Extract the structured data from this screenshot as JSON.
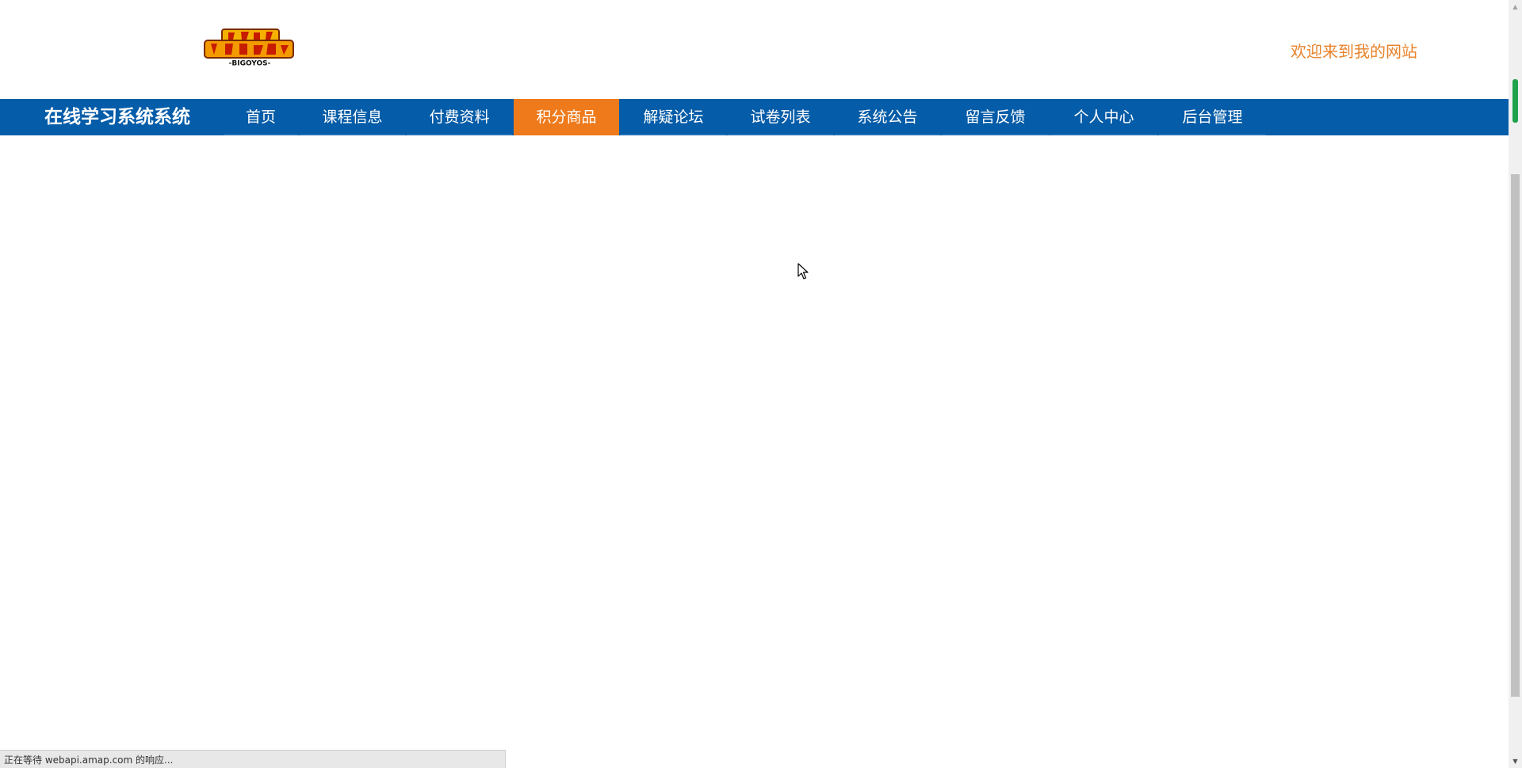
{
  "header": {
    "logo_alt": "デジモンアドベンチャー -BIGOYOS-",
    "welcome_text": "欢迎来到我的网站"
  },
  "navbar": {
    "brand": "在线学习系统系统",
    "items": [
      {
        "label": "首页",
        "active": false
      },
      {
        "label": "课程信息",
        "active": false
      },
      {
        "label": "付费资料",
        "active": false
      },
      {
        "label": "积分商品",
        "active": true
      },
      {
        "label": "解疑论坛",
        "active": false
      },
      {
        "label": "试卷列表",
        "active": false
      },
      {
        "label": "系统公告",
        "active": false
      },
      {
        "label": "留言反馈",
        "active": false
      },
      {
        "label": "个人中心",
        "active": false
      },
      {
        "label": "后台管理",
        "active": false
      }
    ]
  },
  "status_bar": {
    "text": "正在等待 webapi.amap.com 的响应..."
  },
  "colors": {
    "nav_bg": "#055ca8",
    "active_bg": "#ee7a1b",
    "welcome": "#e8832c"
  }
}
